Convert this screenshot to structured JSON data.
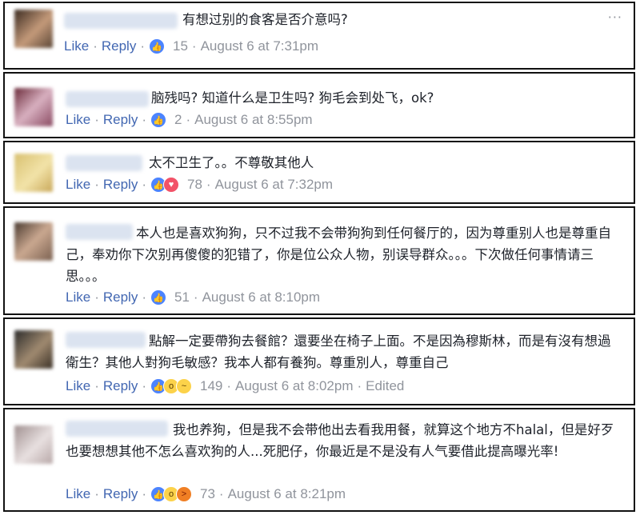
{
  "comments": [
    {
      "text": "有想过别的食客是否介意吗?",
      "like": "Like",
      "reply": "Reply",
      "count": "15",
      "time": "August 6 at 7:31pm",
      "edited": "",
      "reactions": [
        "like-icon"
      ]
    },
    {
      "text": "脑残吗? 知道什么是卫生吗? 狗毛会到处飞，ok?",
      "like": "Like",
      "reply": "Reply",
      "count": "2",
      "time": "August 6 at 8:55pm",
      "edited": "",
      "reactions": [
        "like-icon"
      ]
    },
    {
      "text": "太不卫生了。。不尊敬其他人",
      "like": "Like",
      "reply": "Reply",
      "count": "78",
      "time": "August 6 at 7:32pm",
      "edited": "",
      "reactions": [
        "like-icon",
        "love-icon"
      ]
    },
    {
      "text": "本人也是喜欢狗狗，只不过我不会带狗狗到任何餐厅的，因为尊重别人也是尊重自己，奉劝你下次别再傻傻的犯错了，你是位公众人物，别误导群众。。。下次做任何事情请三思。。。",
      "like": "Like",
      "reply": "Reply",
      "count": "51",
      "time": "August 6 at 8:10pm",
      "edited": "",
      "reactions": [
        "like-icon"
      ]
    },
    {
      "text": "點解一定要帶狗去餐館？還要坐在椅子上面。不是因為穆斯林，而是有沒有想過衛生？其他人對狗毛敏感？我本人都有養狗。尊重別人，尊重自己",
      "like": "Like",
      "reply": "Reply",
      "count": "149",
      "time": "August 6 at 8:02pm",
      "edited": "Edited",
      "reactions": [
        "like-icon",
        "wow-icon",
        "sad-icon"
      ]
    },
    {
      "text": "我也养狗，但是我不会带他出去看我用餐，就算这个地方不halal，但是好歹也要想想其他不怎么喜欢狗的人...死肥仔，你最近是不是没有人气要借此提高曝光率!",
      "like": "Like",
      "reply": "Reply",
      "count": "73",
      "time": "August 6 at 8:21pm",
      "edited": "",
      "reactions": [
        "like-icon",
        "wow-icon",
        "angry-icon"
      ]
    }
  ],
  "more_options": "···",
  "colors": {
    "link": "#4267b2",
    "meta": "#90949c",
    "text": "#1d2129"
  }
}
